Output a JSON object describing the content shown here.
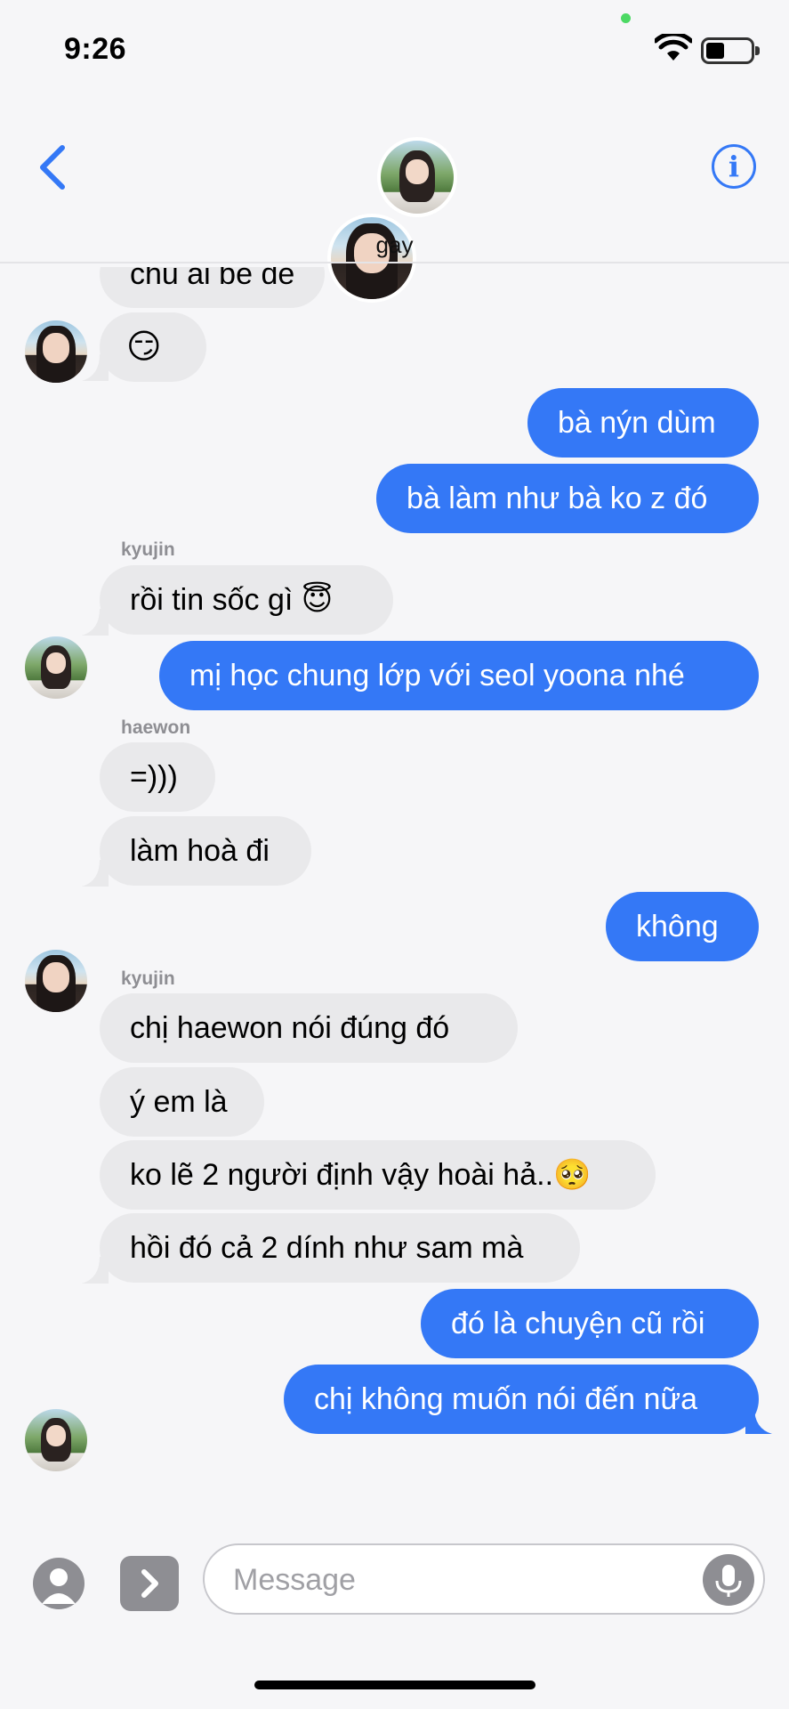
{
  "status_bar": {
    "time": "9:26"
  },
  "header": {
    "title": "gay",
    "info_glyph": "i"
  },
  "messages": {
    "m0": "chu ai be de",
    "m1": "😏",
    "m2": "bà nýn dùm",
    "m3": "bà làm như bà ko z đó",
    "label_kyujin_1": "kyujin",
    "m4": "rồi tin sốc gì 😇",
    "m5": "mị học chung lớp với seol yoona nhé",
    "label_haewon": "haewon",
    "m6": "=)))",
    "m7": "làm hoà đi",
    "m8": "không",
    "label_kyujin_2": "kyujin",
    "m9": "chị haewon nói đúng đó",
    "m10": "ý em là",
    "m11": "ko lẽ 2 người định vậy hoài hả..🥺",
    "m12": "hồi đó cả 2 dính như sam mà",
    "m13": "đó là chuyện cũ rồi",
    "m14": "chị không muốn nói đến nữa"
  },
  "input": {
    "placeholder": "Message"
  },
  "colors": {
    "accent": "#3478f6",
    "incoming": "#e9e9eb",
    "background": "#f6f6f8"
  }
}
